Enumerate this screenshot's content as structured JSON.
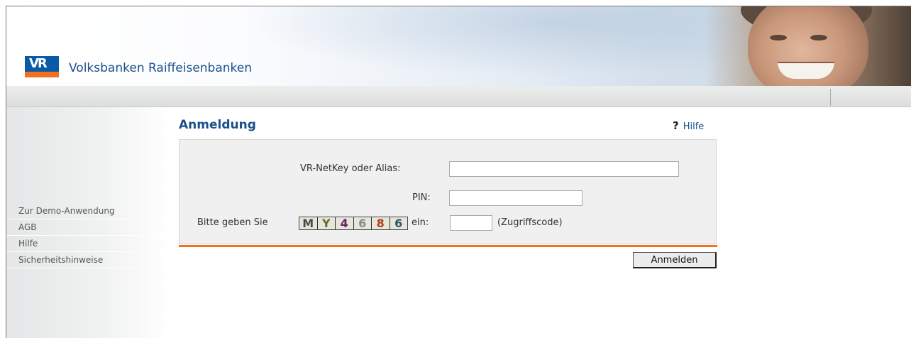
{
  "header": {
    "brand_name": "Volksbanken Raiffeisenbanken",
    "logo_text": "VR",
    "brand_color": "#1c4f8a",
    "accent_color": "#f37021"
  },
  "sidebar": {
    "items": [
      {
        "label": "Zur Demo-Anwendung"
      },
      {
        "label": "AGB"
      },
      {
        "label": "Hilfe"
      },
      {
        "label": "Sicherheitshinweise"
      }
    ]
  },
  "main": {
    "title": "Anmeldung",
    "help_label": "Hilfe",
    "help_icon": "help-question-icon",
    "form": {
      "netkey_label": "VR-NetKey oder Alias:",
      "netkey_value": "",
      "pin_label": "PIN:",
      "pin_value": "",
      "captcha_prefix": "Bitte geben Sie",
      "captcha_suffix": "ein:",
      "captcha_chars": [
        "M",
        "Y",
        "4",
        "6",
        "8",
        "6"
      ],
      "captcha_colors": [
        "#4a4a4a",
        "#6b6b2a",
        "#6a1f6a",
        "#8a8a8a",
        "#b03b1a",
        "#2a5a6a"
      ],
      "access_code_value": "",
      "access_code_hint": "(Zugriffscode)",
      "submit_label": "Anmelden"
    }
  }
}
